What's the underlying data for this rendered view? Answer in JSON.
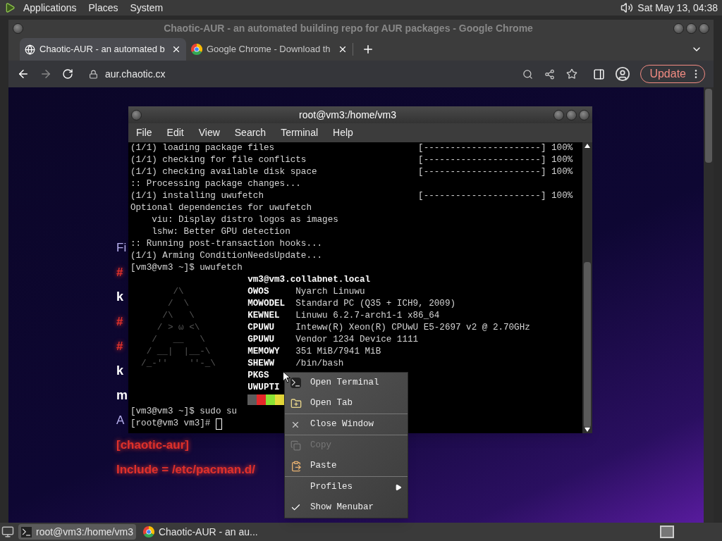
{
  "top_panel": {
    "menus": [
      "Applications",
      "Places",
      "System"
    ],
    "clock": "Sat May 13, 04:38"
  },
  "browser": {
    "title": "Chaotic-AUR - an automated building repo for AUR packages - Google Chrome",
    "tabs": [
      {
        "label": "Chaotic-AUR - an automated b",
        "selected": true
      },
      {
        "label": "Google Chrome - Download th",
        "selected": false
      }
    ],
    "url": "aur.chaotic.cx",
    "update_button": "Update",
    "page_lines": [
      {
        "text": "Fi",
        "kind": "text"
      },
      {
        "text": "#",
        "kind": "comment"
      },
      {
        "text": "k",
        "kind": "bold"
      },
      {
        "text": "#",
        "kind": "comment"
      },
      {
        "text": "#",
        "kind": "comment"
      },
      {
        "text": "k",
        "kind": "bold"
      },
      {
        "text": "m",
        "kind": "bold"
      },
      {
        "text": "A",
        "kind": "text"
      },
      {
        "text": "[chaotic-aur]",
        "kind": "code"
      },
      {
        "text": "Include = /etc/pacman.d/",
        "kind": "code"
      }
    ]
  },
  "terminal": {
    "title": "root@vm3:/home/vm3",
    "menu": [
      "File",
      "Edit",
      "View",
      "Search",
      "Terminal",
      "Help"
    ],
    "log": [
      {
        "text": "(1/1) loading package files",
        "progress": "[----------------------] 100%"
      },
      {
        "text": "(1/1) checking for file conflicts",
        "progress": "[----------------------] 100%"
      },
      {
        "text": "(1/1) checking available disk space",
        "progress": "[----------------------] 100%"
      },
      {
        "text": ":: Processing package changes..."
      },
      {
        "text": "(1/1) installing uwufetch",
        "progress": "[----------------------] 100%"
      },
      {
        "text": "Optional dependencies for uwufetch"
      },
      {
        "text": "    viu: Display distro logos as images"
      },
      {
        "text": "    lshw: Better GPU detection"
      },
      {
        "text": ":: Running post-transaction hooks..."
      },
      {
        "text": "(1/1) Arming ConditionNeedsUpdate..."
      },
      {
        "text": "[vm3@vm3 ~]$ uwufetch"
      }
    ],
    "fetch": {
      "header": "vm3@vm3.collabnet.local",
      "ascii_art": [
        "        /\\",
        "       /  \\",
        "      /\\   \\",
        "     / > ω <\\",
        "    /   __   \\",
        "   / __|  |__-\\",
        "  /_-''    ''-_\\"
      ],
      "fields": [
        {
          "label": "OWOS",
          "value": "Nyarch Linuwu"
        },
        {
          "label": "MOWODEL",
          "value": "Standard PC (Q35 + ICH9, 2009)"
        },
        {
          "label": "KEWNEL",
          "value": "Linuwu 6.2.7-arch1-1 x86_64"
        },
        {
          "label": "CPUWU",
          "value": "Inteww(R) Xeon(R) CPUwU E5-2697 v2 @ 2.70GHz"
        },
        {
          "label": "GPUWU",
          "value": "Vendor 1234 Device 1111"
        },
        {
          "label": "MEMOWY",
          "value": "351 MiB/7941 MiB"
        },
        {
          "label": "SHEWW",
          "value": "/bin/bash"
        },
        {
          "label": "PKGS"
        },
        {
          "label": "UWUPTI"
        }
      ]
    },
    "after": [
      "[vm3@vm3 ~]$ sudo su",
      "[root@vm3 vm3]# "
    ]
  },
  "context_menu": {
    "groups": [
      [
        {
          "label": "Open Terminal",
          "kind": "action",
          "disabled": false
        },
        {
          "label": "Open Tab",
          "kind": "action",
          "disabled": false
        }
      ],
      [
        {
          "label": "Close Window",
          "kind": "action",
          "disabled": false
        }
      ],
      [
        {
          "label": "Copy",
          "kind": "action",
          "disabled": true
        },
        {
          "label": "Paste",
          "kind": "action",
          "disabled": false
        }
      ],
      [
        {
          "label": "Profiles",
          "kind": "submenu",
          "disabled": false
        },
        {
          "label": "Show Menubar",
          "kind": "toggle",
          "checked": true,
          "disabled": false
        }
      ]
    ]
  },
  "taskbar": {
    "tasks": [
      {
        "label": "root@vm3:/home/vm3",
        "selected": true
      },
      {
        "label": "Chaotic-AUR - an au...",
        "selected": false
      }
    ]
  }
}
